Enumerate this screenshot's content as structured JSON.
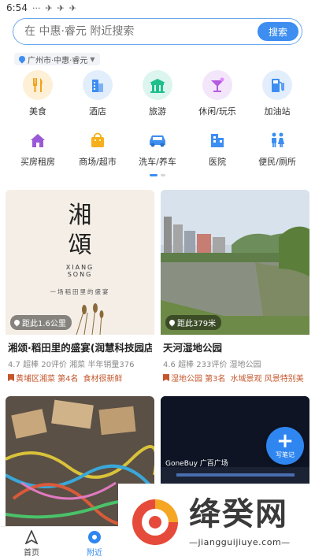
{
  "statusbar": {
    "time": "6:54",
    "icons": [
      "···",
      "✈",
      "✈",
      "✈"
    ]
  },
  "search": {
    "placeholder": "在 中惠·睿元 附近搜索",
    "button": "搜索"
  },
  "location": {
    "label": "广州市·中惠·睿元"
  },
  "categories_row1": [
    {
      "label": "美食",
      "icon": "food-icon",
      "bg": "#fdf0d6"
    },
    {
      "label": "酒店",
      "icon": "hotel-icon",
      "bg": "#e3eefc"
    },
    {
      "label": "旅游",
      "icon": "travel-icon",
      "bg": "#dcf5ee"
    },
    {
      "label": "休闲/玩乐",
      "icon": "cocktail-icon",
      "bg": "#f3e6fb"
    },
    {
      "label": "加油站",
      "icon": "gas-station-icon",
      "bg": "#e3eefc"
    }
  ],
  "categories_row2": [
    {
      "label": "买房租房",
      "icon": "house-icon"
    },
    {
      "label": "商场/超市",
      "icon": "shopping-bag-icon"
    },
    {
      "label": "洗车/养车",
      "icon": "car-icon"
    },
    {
      "label": "医院",
      "icon": "hospital-icon"
    },
    {
      "label": "便民/厕所",
      "icon": "toilet-icon"
    }
  ],
  "cards": [
    {
      "title": "湘颂·稻田里的盛宴(润慧科技园店)",
      "distance": "距此1.6公里",
      "meta": "4.7 超棒  20评价  湘菜  半年销量376",
      "rank": "黄埔区湘菜 第4名",
      "extra": "食材很新鲜",
      "image_text": {
        "big1": "湘",
        "big2": "頌",
        "en1": "XIANG",
        "en2": "SONG",
        "slogan": "一场稻田里的盛宴"
      }
    },
    {
      "title": "天河湿地公园",
      "distance": "距此379米",
      "meta": "4.6 超棒  233评价  湿地公园",
      "rank": "湿地公园 第3名",
      "extra": "水域景观  风景特别美"
    },
    {
      "title": "",
      "distance": ""
    },
    {
      "title": "",
      "distance": "",
      "sign_text": "GoneBuy 广百广场"
    }
  ],
  "fab": {
    "label": "写笔记"
  },
  "tabs": [
    {
      "label": "首页",
      "icon": "navigation-arrow-icon"
    },
    {
      "label": "附近",
      "icon": "location-icon"
    }
  ],
  "watermark": {
    "name": "绛癸网",
    "url": "—jiangguijiuye.com—"
  }
}
